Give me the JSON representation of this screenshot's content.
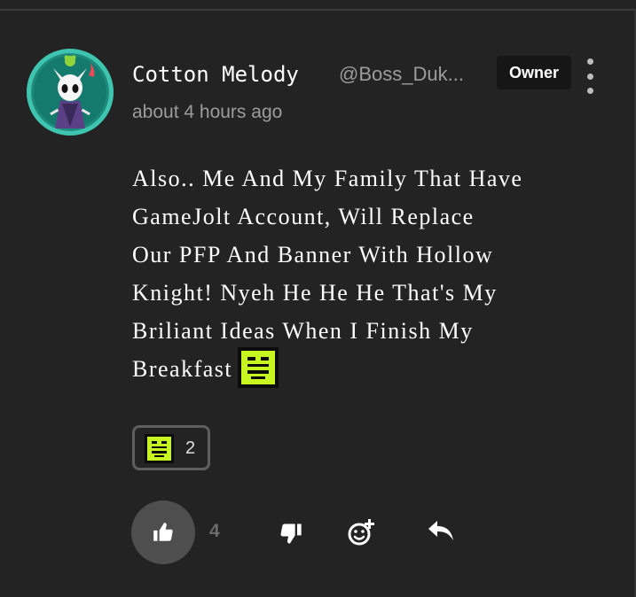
{
  "comment": {
    "author": {
      "display_name": "Cotton Melody",
      "username": "@Boss_Duk...",
      "role_badge": "Owner",
      "avatar_icon": "hollow-knight-avatar-icon"
    },
    "timestamp": "about 4 hours ago",
    "body_lines": [
      "Also.. Me And My Family That Have",
      "GameJolt Account, Will Replace",
      "Our PFP And Banner With Hollow",
      "Knight! Nyeh He He He That's My",
      "Briliant Ideas When I Finish My",
      "Breakfast"
    ],
    "inline_emoji": "grin-emoji-icon",
    "reactions": [
      {
        "emoji": "grin-emoji-icon",
        "count": "2"
      }
    ],
    "actions": {
      "like_count": "4",
      "like_icon": "thumbs-up-icon",
      "dislike_icon": "thumbs-down-icon",
      "add_reaction_icon": "add-reaction-icon",
      "reply_icon": "reply-icon",
      "more_icon": "more-vertical-icon"
    }
  },
  "colors": {
    "background": "#232323",
    "avatar_ring": "#3fc4b0",
    "emoji_green": "#c6f51f",
    "muted_text": "#9c9c9c",
    "like_bubble": "#4e4e4e"
  }
}
